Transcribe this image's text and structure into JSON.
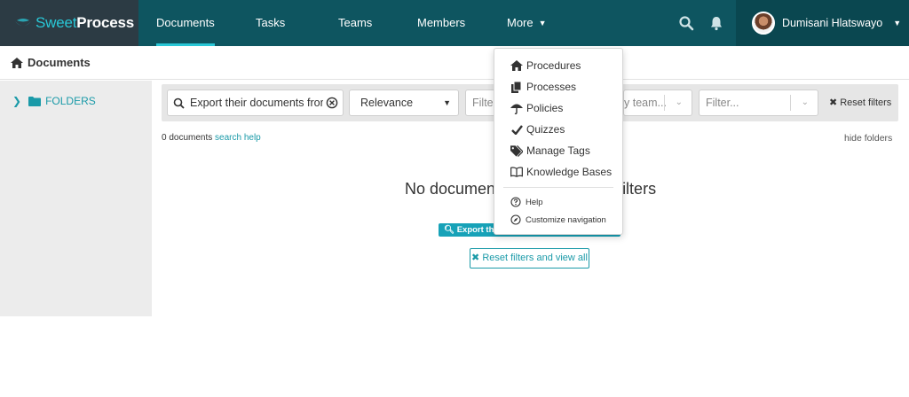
{
  "brand": {
    "name_part1": "Sweet",
    "name_part2": "Process"
  },
  "nav": {
    "items": [
      {
        "label": "Documents"
      },
      {
        "label": "Tasks"
      },
      {
        "label": "Teams"
      },
      {
        "label": "Members"
      },
      {
        "label": "More"
      }
    ],
    "user": {
      "name": "Dumisani Hlatswayo"
    }
  },
  "breadcrumb": {
    "label": "Documents"
  },
  "sidebar": {
    "folders_label": "FOLDERS"
  },
  "filters": {
    "search_value": "Export their documents from",
    "sort_value": "Relevance",
    "filter1_placeholder": "Filter...",
    "filter2_placeholder": "y team...",
    "filter3_placeholder": "Filter...",
    "reset_label": "Reset filters"
  },
  "results": {
    "count_text": "0 documents",
    "search_help": "search help",
    "hide_folders": "hide folders",
    "empty_title_left": "No document",
    "empty_title_right": "ilters",
    "export_badge": "Export the",
    "reset_button": "Reset filters and view all"
  },
  "more_menu": {
    "items": [
      {
        "label": "Procedures",
        "icon": "home-icon"
      },
      {
        "label": "Processes",
        "icon": "copy-icon"
      },
      {
        "label": "Policies",
        "icon": "umbrella-icon"
      },
      {
        "label": "Quizzes",
        "icon": "check-icon"
      },
      {
        "label": "Manage Tags",
        "icon": "tags-icon"
      },
      {
        "label": "Knowledge Bases",
        "icon": "book-icon"
      }
    ],
    "footer": [
      {
        "label": "Help",
        "icon": "question-circle-icon"
      },
      {
        "label": "Customize navigation",
        "icon": "compass-icon"
      }
    ]
  },
  "colors": {
    "nav_bg": "#0e5560",
    "accent": "#29c7d6",
    "link": "#1a9aa8",
    "logo_bg": "#2c3b44"
  }
}
